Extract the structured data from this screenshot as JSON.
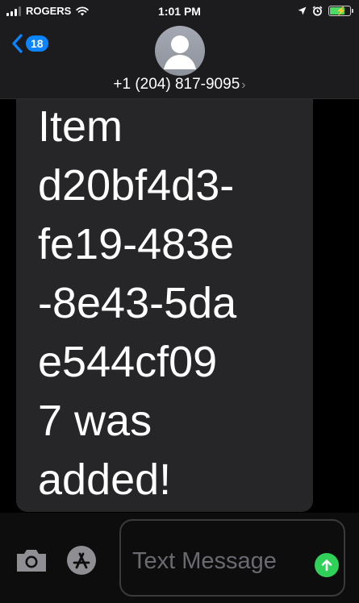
{
  "status_bar": {
    "carrier": "ROGERS",
    "time": "1:01 PM"
  },
  "header": {
    "unread_count": "18",
    "contact": "+1 (204) 817-9095",
    "contact_chevron": "›"
  },
  "message": {
    "text": "Item\nd20bf4d3-\nfe19-483e\n-8e43-5da\ne544cf09\n7 was\nadded!"
  },
  "input": {
    "placeholder": "Text Message"
  },
  "colors": {
    "accent_blue": "#0a84ff",
    "send_green": "#30d158",
    "bubble_gray": "#262628",
    "battery_green": "#4cd964"
  },
  "icons": {
    "status": [
      "signal-icon",
      "wifi-icon",
      "location-icon",
      "alarm-icon",
      "battery-icon"
    ],
    "header": [
      "chevron-left-icon",
      "avatar-icon",
      "chevron-right-icon"
    ],
    "input": [
      "camera-icon",
      "app-store-icon",
      "send-arrow-icon"
    ]
  }
}
